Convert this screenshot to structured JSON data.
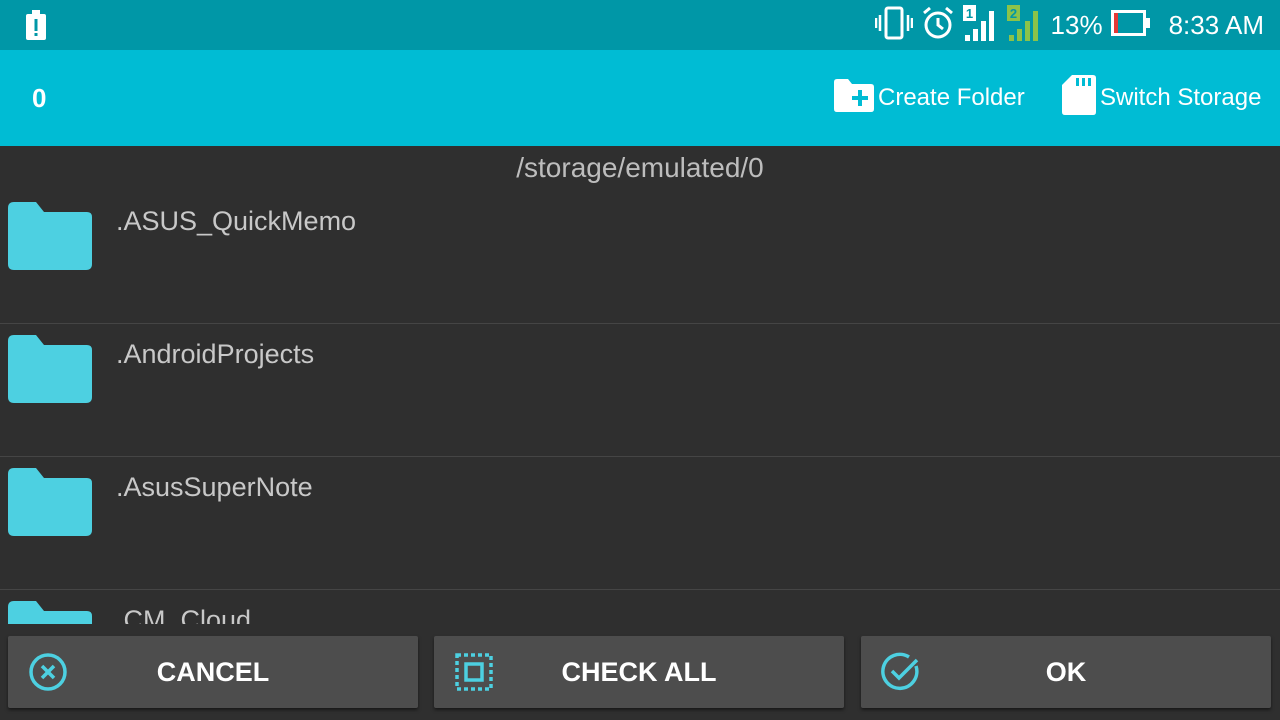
{
  "status_bar": {
    "battery_percent": "13%",
    "time": "8:33 AM",
    "sim1_label": "1",
    "sim2_label": "2",
    "icons": [
      "alert-icon",
      "vibrate-icon",
      "alarm-icon",
      "signal-sim1-icon",
      "signal-sim2-icon",
      "battery-low-icon"
    ],
    "battery_level": 0.13
  },
  "app_bar": {
    "selected_count": "0",
    "create_folder_label": "Create Folder",
    "switch_storage_label": "Switch Storage",
    "icons": [
      "create-folder-icon",
      "sd-card-icon"
    ]
  },
  "path": "/storage/emulated/0",
  "folders": [
    {
      "name": ".ASUS_QuickMemo"
    },
    {
      "name": ".AndroidProjects"
    },
    {
      "name": ".AsusSuperNote"
    },
    {
      "name": ".CM_Cloud"
    }
  ],
  "buttons": {
    "cancel_label": "CANCEL",
    "check_all_label": "CHECK ALL",
    "ok_label": "OK",
    "icons": [
      "cancel-circle-icon",
      "select-all-icon",
      "check-circle-icon"
    ]
  },
  "colors": {
    "status_bar": "#0097a7",
    "app_bar": "#00bcd4",
    "folder": "#4dd0e1",
    "background": "#2f2f2f",
    "button": "#4d4d4d",
    "battery_low": "#e53935",
    "sim2_signal": "#8bc34a"
  }
}
